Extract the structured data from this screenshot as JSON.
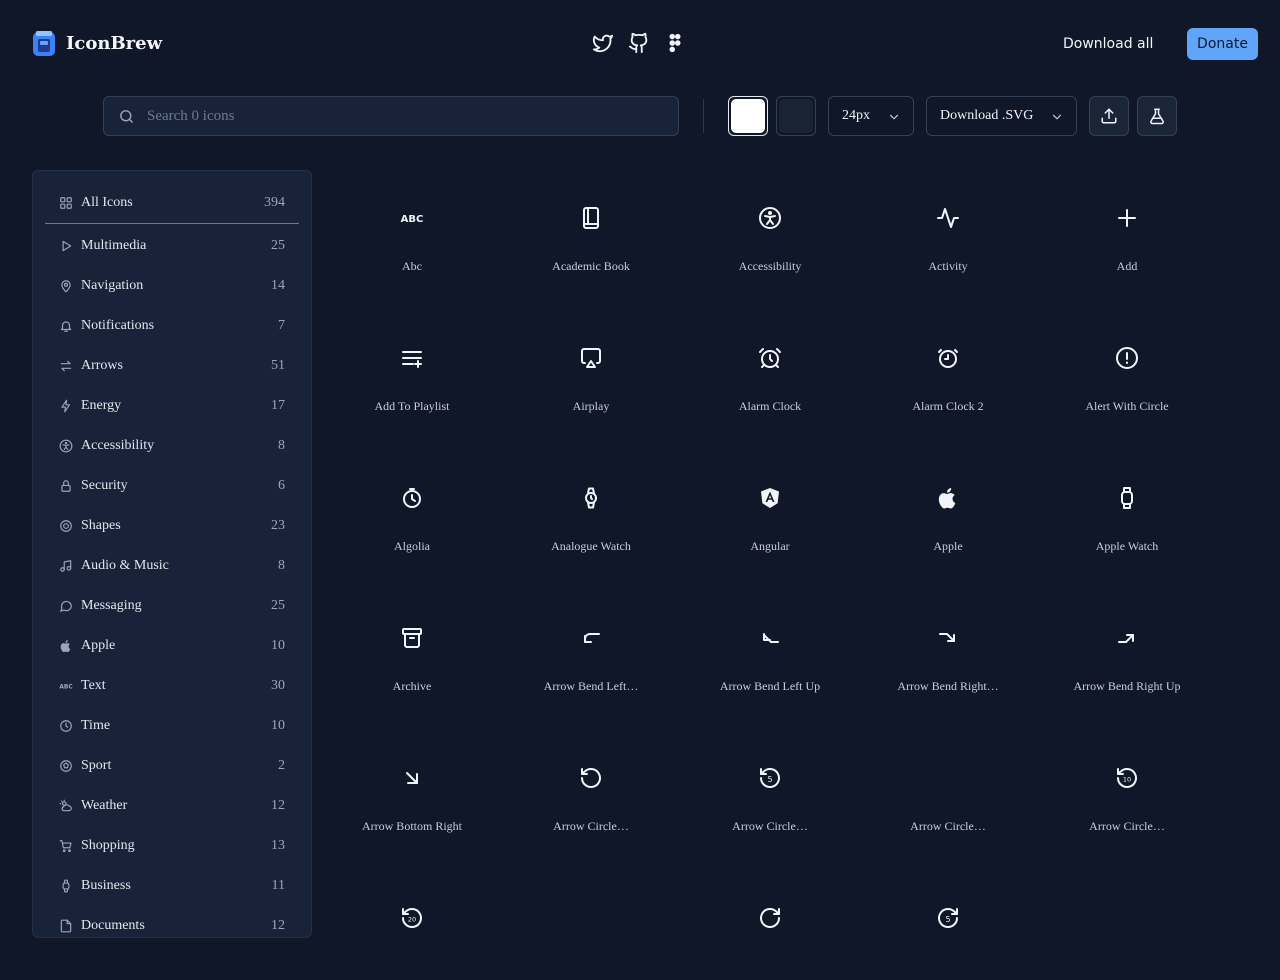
{
  "app": {
    "name": "IconBrew"
  },
  "header": {
    "socials": [
      "twitter-icon",
      "github-icon",
      "figma-icon"
    ],
    "download_all": "Download all",
    "donate": "Donate"
  },
  "toolbar": {
    "search_placeholder": "Search 0 icons",
    "swatch_colors": {
      "light": "#ffffff",
      "dark": "#1b2434"
    },
    "size": "24px",
    "download_format": "Download .SVG"
  },
  "sidebar": {
    "all": {
      "label": "All Icons",
      "count": "394"
    },
    "items": [
      {
        "label": "Multimedia",
        "count": "25",
        "icon": "play-icon"
      },
      {
        "label": "Navigation",
        "count": "14",
        "icon": "map-pin-icon"
      },
      {
        "label": "Notifications",
        "count": "7",
        "icon": "bell-icon"
      },
      {
        "label": "Arrows",
        "count": "51",
        "icon": "arrows-swap-icon"
      },
      {
        "label": "Energy",
        "count": "17",
        "icon": "lightning-icon"
      },
      {
        "label": "Accessibility",
        "count": "8",
        "icon": "accessibility-icon"
      },
      {
        "label": "Security",
        "count": "6",
        "icon": "lock-icon"
      },
      {
        "label": "Shapes",
        "count": "23",
        "icon": "target-icon"
      },
      {
        "label": "Audio & Music",
        "count": "8",
        "icon": "music-note-icon"
      },
      {
        "label": "Messaging",
        "count": "25",
        "icon": "chat-bubble-icon"
      },
      {
        "label": "Apple",
        "count": "10",
        "icon": "apple-icon"
      },
      {
        "label": "Text",
        "count": "30",
        "icon": "abc-icon"
      },
      {
        "label": "Time",
        "count": "10",
        "icon": "clock-icon"
      },
      {
        "label": "Sport",
        "count": "2",
        "icon": "ball-icon"
      },
      {
        "label": "Weather",
        "count": "12",
        "icon": "cloud-sun-icon"
      },
      {
        "label": "Shopping",
        "count": "13",
        "icon": "cart-icon"
      },
      {
        "label": "Business",
        "count": "11",
        "icon": "watch-icon"
      },
      {
        "label": "Documents",
        "count": "12",
        "icon": "file-icon"
      }
    ]
  },
  "grid": {
    "icons": [
      {
        "name": "Abc",
        "icon": "abc-icon"
      },
      {
        "name": "Academic Book",
        "icon": "book-icon"
      },
      {
        "name": "Accessibility",
        "icon": "accessibility-icon"
      },
      {
        "name": "Activity",
        "icon": "activity-icon"
      },
      {
        "name": "Add",
        "icon": "plus-icon"
      },
      {
        "name": "Add To Playlist",
        "icon": "add-to-playlist-icon"
      },
      {
        "name": "Airplay",
        "icon": "airplay-icon"
      },
      {
        "name": "Alarm Clock",
        "icon": "alarm-clock-icon"
      },
      {
        "name": "Alarm Clock 2",
        "icon": "alarm-clock-2-icon"
      },
      {
        "name": "Alert With Circle",
        "icon": "alert-circle-icon"
      },
      {
        "name": "Algolia",
        "icon": "algolia-icon"
      },
      {
        "name": "Analogue Watch",
        "icon": "analogue-watch-icon"
      },
      {
        "name": "Angular",
        "icon": "angular-icon"
      },
      {
        "name": "Apple",
        "icon": "apple-icon"
      },
      {
        "name": "Apple Watch",
        "icon": "apple-watch-icon"
      },
      {
        "name": "Archive",
        "icon": "archive-icon"
      },
      {
        "name": "Arrow Bend Left…",
        "icon": "arrow-bend-left-down-icon"
      },
      {
        "name": "Arrow Bend Left Up",
        "icon": "arrow-bend-left-up-icon"
      },
      {
        "name": "Arrow Bend Right…",
        "icon": "arrow-bend-right-down-icon"
      },
      {
        "name": "Arrow Bend Right Up",
        "icon": "arrow-bend-right-up-icon"
      },
      {
        "name": "Arrow Bottom Right",
        "icon": "arrow-bottom-right-icon"
      },
      {
        "name": "Arrow Circle…",
        "icon": "arrow-circle-left-icon"
      },
      {
        "name": "Arrow Circle…",
        "icon": "arrow-circle-5-icon"
      },
      {
        "name": "Arrow Circle…",
        "icon": "blank-icon"
      },
      {
        "name": "Arrow Circle…",
        "icon": "arrow-circle-10-icon"
      },
      {
        "name": "",
        "icon": "arrow-circle-20-icon"
      },
      {
        "name": "",
        "icon": "blank-icon"
      },
      {
        "name": "",
        "icon": "arrow-circle-right-icon"
      },
      {
        "name": "",
        "icon": "arrow-circle-right-5-icon"
      }
    ]
  }
}
